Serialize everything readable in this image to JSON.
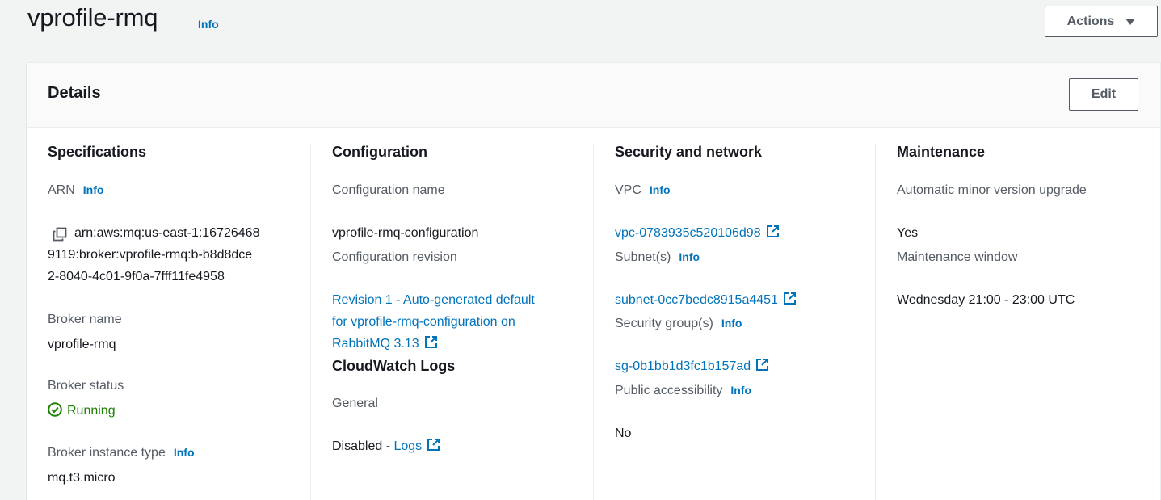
{
  "header": {
    "title": "vprofile-rmq",
    "info_label": "Info",
    "actions_label": "Actions"
  },
  "details": {
    "title": "Details",
    "edit_label": "Edit",
    "specifications": {
      "title": "Specifications",
      "arn_label": "ARN",
      "arn_lines": [
        "arn:aws:mq:us-east-1:16726468",
        "9119:broker:vprofile-rmq:b-b8d8dce",
        "2-8040-4c01-9f0a-7fff11fe4958"
      ],
      "broker_name_label": "Broker name",
      "broker_name": "vprofile-rmq",
      "broker_status_label": "Broker status",
      "broker_status": "Running",
      "instance_type_label": "Broker instance type",
      "instance_type": "mq.t3.micro"
    },
    "configuration": {
      "title": "Configuration",
      "config_name_label": "Configuration name",
      "config_name": "vprofile-rmq-configuration",
      "config_revision_label": "Configuration revision",
      "config_revision_lines": [
        "Revision 1 - Auto-generated default",
        "for vprofile-rmq-configuration on",
        "RabbitMQ 3.13"
      ],
      "cloudwatch_title": "CloudWatch Logs",
      "general_label": "General",
      "general_value": "Disabled - ",
      "logs_link": "Logs"
    },
    "security": {
      "title": "Security and network",
      "vpc_label": "VPC",
      "vpc": "vpc-0783935c520106d98",
      "subnet_label": "Subnet(s)",
      "subnet": "subnet-0cc7bedc8915a4451",
      "sg_label": "Security group(s)",
      "sg": "sg-0b1bb1d3fc1b157ad",
      "public_label": "Public accessibility",
      "public": "No"
    },
    "maintenance": {
      "title": "Maintenance",
      "auto_upgrade_label": "Automatic minor version upgrade",
      "auto_upgrade": "Yes",
      "window_label": "Maintenance window",
      "window": "Wednesday 21:00 - 23:00 UTC"
    }
  },
  "colors": {
    "link": "#0073bb",
    "success": "#1d8102",
    "text": "#16191f",
    "label": "#545b64"
  }
}
